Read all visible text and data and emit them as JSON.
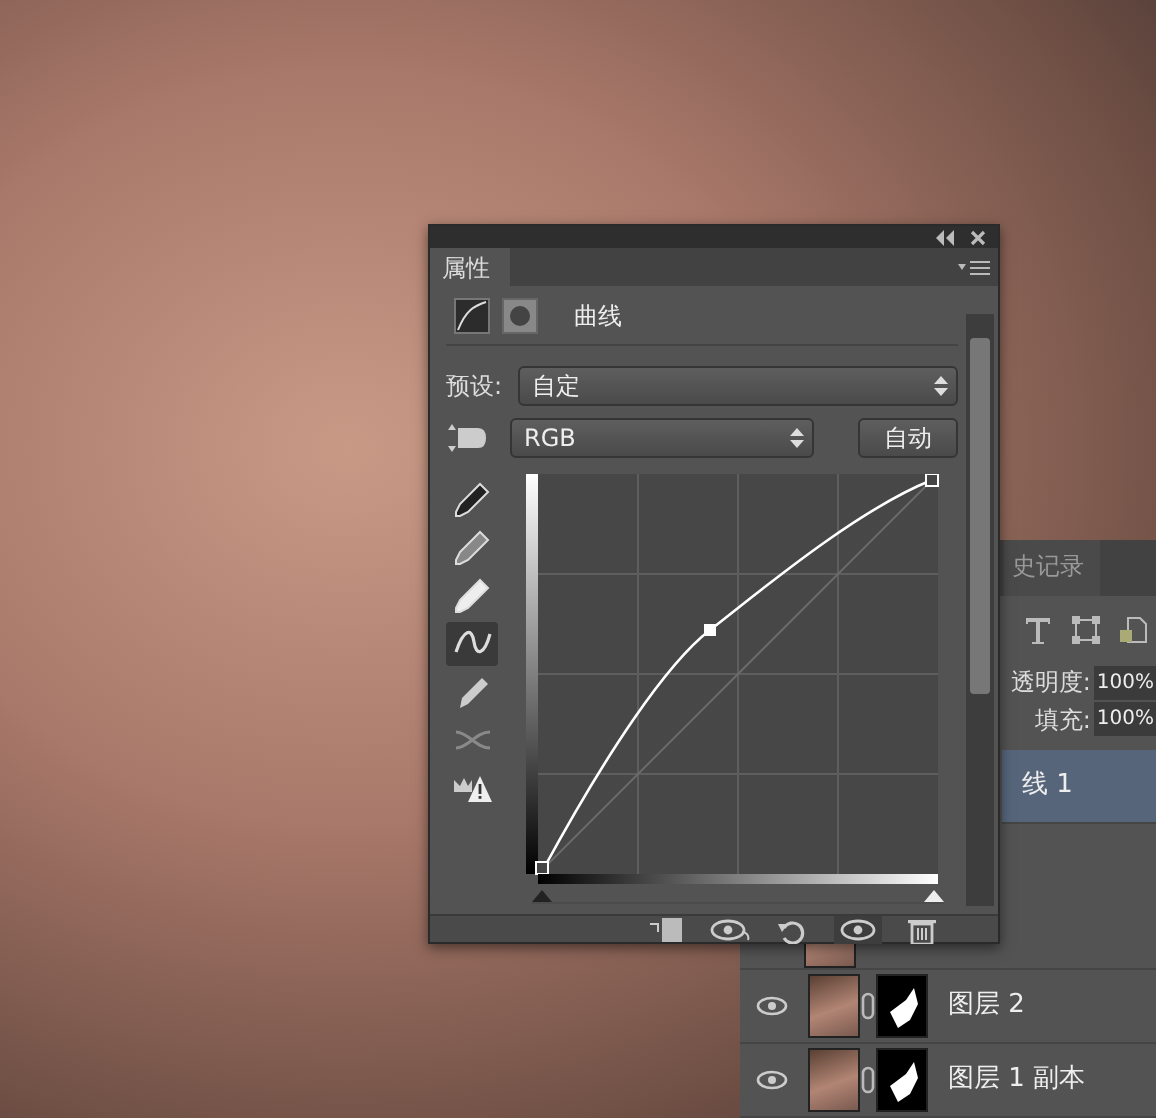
{
  "properties_panel": {
    "tab": "属性",
    "adjustment": "曲线",
    "preset": {
      "label": "预设:",
      "value": "自定"
    },
    "channel": "RGB",
    "auto_button": "自动",
    "tools": [
      {
        "kind": "eyedropper-black",
        "selected": false,
        "disabled": false
      },
      {
        "kind": "eyedropper-gray",
        "selected": false,
        "disabled": false
      },
      {
        "kind": "eyedropper-white",
        "selected": false,
        "disabled": false
      },
      {
        "kind": "curve",
        "selected": true,
        "disabled": false
      },
      {
        "kind": "pencil",
        "selected": false,
        "disabled": false
      },
      {
        "kind": "smooth",
        "selected": false,
        "disabled": true
      },
      {
        "kind": "clipping",
        "selected": false,
        "disabled": false
      }
    ],
    "input_sliders": [
      {
        "level": 0
      },
      {
        "level": 1
      }
    ],
    "footer_buttons": [
      {
        "kind": "clip",
        "selected": false
      },
      {
        "kind": "view-previous",
        "selected": false
      },
      {
        "kind": "reset",
        "selected": false
      },
      {
        "kind": "visibility",
        "selected": true
      },
      {
        "kind": "delete",
        "selected": false
      }
    ]
  },
  "layers_panel": {
    "tab": "史记录",
    "opacity": {
      "label": "透明度:",
      "value": "100%"
    },
    "fill": {
      "label": "填充:",
      "value": "100%"
    },
    "layers": [
      {
        "name": "线 1",
        "selected": true
      },
      {
        "name": "图层 2",
        "selected": false,
        "visible": true
      },
      {
        "name": "图层 1 副本",
        "selected": false,
        "visible": true
      }
    ]
  }
}
